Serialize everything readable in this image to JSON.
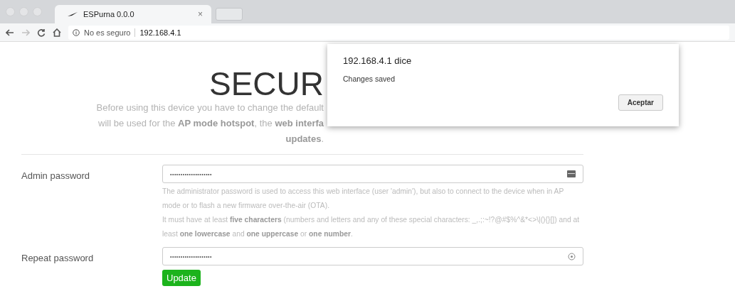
{
  "browser": {
    "tab": {
      "title": "ESPurna 0.0.0",
      "close": "×"
    },
    "nav": {
      "back_disabled": false,
      "forward_disabled": true
    },
    "address": {
      "security": "No es seguro",
      "url": "192.168.4.1"
    }
  },
  "page": {
    "title": "SECUR",
    "intro": [
      "Before using this device you have to change the default",
      "will be used for the **AP mode hotspot**, the **web interfa**",
      "**updates**."
    ],
    "fields": [
      {
        "label": "Admin password",
        "value": "••••••••••••••••••••",
        "kind": "card",
        "hints": [
          "The administrator password is used to access this web interface (user 'admin'), but also to connect to the device when in AP mode or to flash a new firmware over-the-air (OTA).",
          "It must have at least **five characters** (numbers and letters and any of these special characters: _,.;:~!?@#$%^&*<>\\|(){}[]) and at least **one lowercase** and **one uppercase** or **one number**."
        ]
      },
      {
        "label": "Repeat password",
        "value": "••••••••••••••••••••",
        "kind": "circle"
      }
    ],
    "button": "Update"
  },
  "dialog": {
    "title": "192.168.4.1 dice",
    "message": "Changes saved",
    "button": "Aceptar"
  }
}
